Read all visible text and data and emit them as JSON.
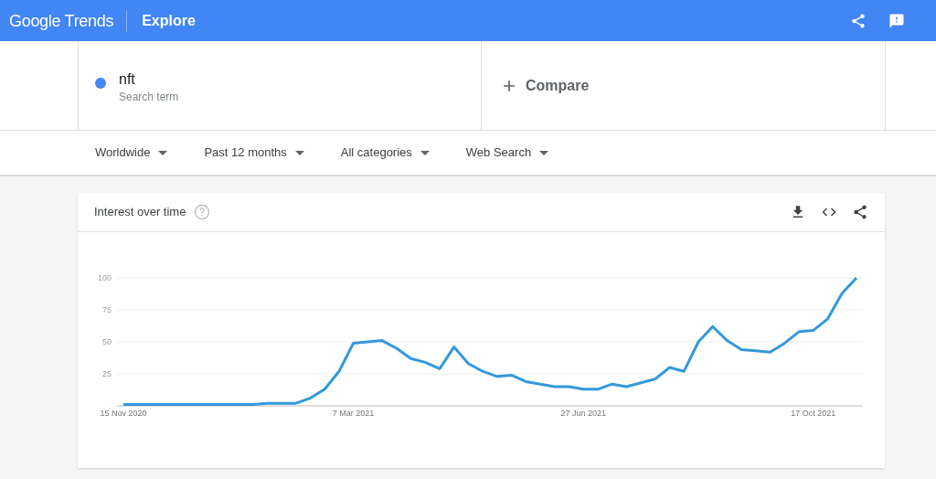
{
  "header": {
    "logo": "Google Trends",
    "title": "Explore"
  },
  "search_terms": [
    {
      "term": "nft",
      "subtitle": "Search term",
      "color": "#4285f4"
    }
  ],
  "compare": {
    "label": "Compare"
  },
  "filters": [
    {
      "label": "Worldwide"
    },
    {
      "label": "Past 12 months"
    },
    {
      "label": "All categories"
    },
    {
      "label": "Web Search"
    }
  ],
  "interest_card": {
    "title": "Interest over time",
    "chart_data": {
      "type": "line",
      "categories": [
        "15 Nov 2020",
        null,
        null,
        null,
        null,
        null,
        null,
        null,
        null,
        null,
        null,
        null,
        null,
        null,
        null,
        null,
        "7 Mar 2021",
        null,
        null,
        null,
        null,
        null,
        null,
        null,
        null,
        null,
        null,
        null,
        null,
        null,
        null,
        null,
        "27 Jun 2021",
        null,
        null,
        null,
        null,
        null,
        null,
        null,
        null,
        null,
        null,
        null,
        null,
        null,
        null,
        null,
        "17 Oct 2021",
        null,
        null,
        null
      ],
      "series": [
        {
          "color": "#3498db",
          "values": [
            1,
            1,
            1,
            1,
            1,
            1,
            1,
            1,
            1,
            1,
            2,
            2,
            2,
            6,
            13,
            27,
            49,
            50,
            51,
            45,
            37,
            34,
            29,
            46,
            33,
            27,
            23,
            24,
            19,
            17,
            15,
            15,
            13,
            13,
            17,
            15,
            18,
            21,
            30,
            27,
            50,
            62,
            51,
            44,
            43,
            42,
            49,
            58,
            59,
            68,
            88,
            100
          ]
        }
      ],
      "ylim": [
        0,
        100
      ],
      "yticks": [
        25,
        50,
        75,
        100
      ],
      "grid": true
    }
  }
}
